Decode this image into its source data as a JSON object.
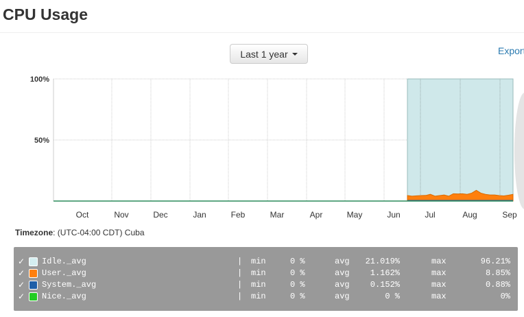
{
  "title": "CPU Usage",
  "range_button": "Last 1 year",
  "export_label": "Export",
  "timezone": {
    "label": "Timezone",
    "value": ": (UTC-04:00 CDT) Cuba"
  },
  "chart_data": {
    "type": "area",
    "ylabel": "",
    "xlabel": "",
    "ylim": [
      0,
      100
    ],
    "yticks": [
      "100%",
      "50%"
    ],
    "x_ticks": [
      "Oct",
      "Nov",
      "Dec",
      "Jan",
      "Feb",
      "Mar",
      "Apr",
      "May",
      "Jun",
      "Jul",
      "Aug",
      "Sep"
    ],
    "grid": true,
    "series": [
      {
        "name": "Idle._avg",
        "color": "#cfe8ea",
        "values": [
          95,
          95,
          95,
          95,
          95,
          95,
          95,
          95,
          95,
          95,
          95,
          95,
          95,
          95,
          95,
          95,
          95,
          95,
          95,
          95,
          95,
          95,
          95,
          95
        ]
      },
      {
        "name": "User._avg",
        "color": "#ff7f0e",
        "values": [
          4.5,
          4,
          4.3,
          4.5,
          4.6,
          5.5,
          4,
          4.5,
          5,
          4,
          6,
          5.8,
          6,
          5.5,
          6.5,
          8.8,
          6.5,
          5.5,
          5,
          5,
          4.5,
          4.2,
          4.8,
          5.5
        ]
      },
      {
        "name": "System._avg",
        "color": "#1f5fa8",
        "values": [
          0.8,
          0.8,
          0.8,
          0.8,
          0.8,
          0.8,
          0.8,
          0.8,
          0.8,
          0.8,
          0.8,
          0.8,
          0.8,
          0.8,
          0.8,
          0.8,
          0.8,
          0.8,
          0.8,
          0.8,
          0.8,
          0.8,
          0.8,
          0.8
        ]
      },
      {
        "name": "Nice._avg",
        "color": "#2ecc2e",
        "values": [
          0,
          0,
          0,
          0,
          0,
          0,
          0,
          0,
          0,
          0,
          0,
          0,
          0,
          0,
          0,
          0,
          0,
          0,
          0,
          0,
          0,
          0,
          0,
          0
        ]
      }
    ],
    "data_span": "late Jun to Sep"
  },
  "legend": [
    {
      "name": "Idle._avg",
      "color": "#d4eef0",
      "min": "0 %",
      "avg": "21.019%",
      "max": "96.21%"
    },
    {
      "name": "User._avg",
      "color": "#ff7f0e",
      "min": "0 %",
      "avg": "1.162%",
      "max": "8.85%"
    },
    {
      "name": "System._avg",
      "color": "#1f5fa8",
      "min": "0 %",
      "avg": "0.152%",
      "max": "0.88%"
    },
    {
      "name": "Nice._avg",
      "color": "#22cc22",
      "min": "0 %",
      "avg": "0 %",
      "max": "0%"
    }
  ],
  "legend_labels": {
    "check": "✓",
    "sep": "|",
    "min": "min",
    "avg": "avg",
    "max": "max"
  }
}
